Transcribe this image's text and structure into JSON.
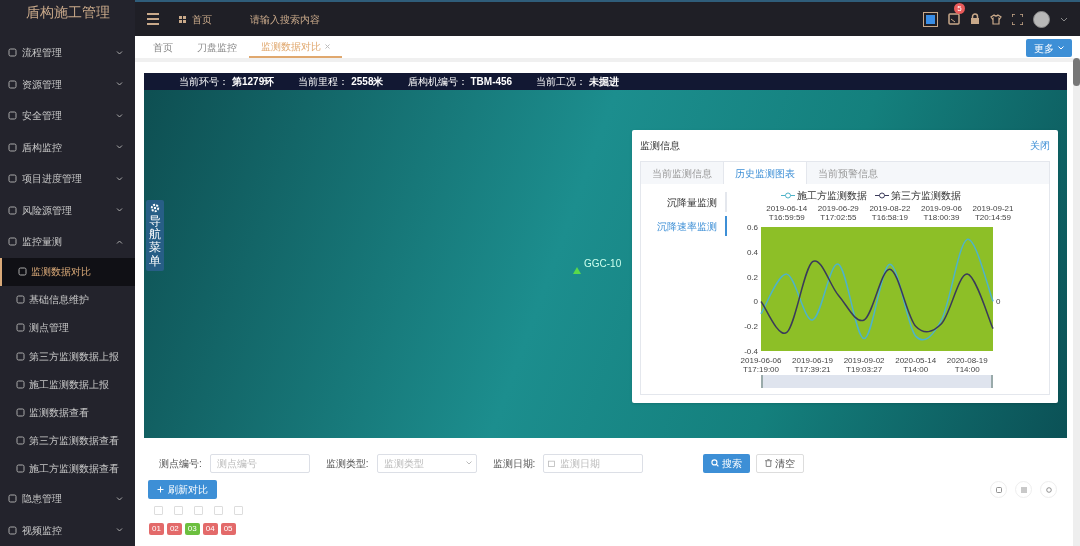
{
  "app": {
    "title": "盾构施工管理"
  },
  "header": {
    "home": "首页",
    "search": {
      "placeholder": "请输入搜索内容"
    },
    "badge": "5"
  },
  "sidebar": {
    "items": [
      {
        "label": "流程管理",
        "expanded": false
      },
      {
        "label": "资源管理",
        "expanded": false
      },
      {
        "label": "安全管理",
        "expanded": false
      },
      {
        "label": "盾构监控",
        "expanded": false
      },
      {
        "label": "项目进度管理",
        "expanded": false
      },
      {
        "label": "风险源管理",
        "expanded": false
      },
      {
        "label": "监控量测",
        "expanded": true,
        "children": [
          {
            "label": "监测数据对比",
            "selected": true
          },
          {
            "label": "基础信息维护",
            "selected": false
          },
          {
            "label": "测点管理",
            "selected": false
          },
          {
            "label": "第三方监测数据上报",
            "selected": false
          },
          {
            "label": "施工监测数据上报",
            "selected": false
          },
          {
            "label": "监测数据查看",
            "selected": false
          },
          {
            "label": "第三方监测数据查看",
            "selected": false
          },
          {
            "label": "施工方监测数据查看",
            "selected": false
          }
        ]
      },
      {
        "label": "隐患管理",
        "expanded": false
      },
      {
        "label": "视频监控",
        "expanded": false
      }
    ]
  },
  "tabs": [
    {
      "label": "首页",
      "selected": false,
      "closable": false
    },
    {
      "label": "刀盘监控",
      "selected": false,
      "closable": false
    },
    {
      "label": "监测数据对比",
      "selected": true,
      "closable": true
    }
  ],
  "more_button": "更多",
  "status_bar": [
    {
      "label": "当前环号：",
      "value": "第1279环"
    },
    {
      "label": "当前里程：",
      "value": "2558米"
    },
    {
      "label": "盾构机编号：",
      "value": "TBM-456"
    },
    {
      "label": "当前工况：",
      "value": "未掘进"
    }
  ],
  "scene": {
    "nav_menu": "导航菜单",
    "marker": "GGC-10"
  },
  "panel": {
    "title": "监测信息",
    "close": "关闭",
    "tabs": [
      {
        "label": "当前监测信息",
        "selected": false
      },
      {
        "label": "历史监测图表",
        "selected": true
      },
      {
        "label": "当前预警信息",
        "selected": false
      }
    ],
    "side_items": [
      {
        "label": "沉降量监测",
        "selected": false
      },
      {
        "label": "沉降速率监测",
        "selected": true
      }
    ],
    "chart_data": {
      "type": "line",
      "categories": [
        "2019-06-06 T17:19:00",
        "2019-06-14 T16:59:59",
        "2019-06-19 T17:39:21",
        "2019-06-29 T17:02:55",
        "2019-09-02 T19:03:27",
        "2019-08-22 T16:58:19",
        "2020-05-14 T14:00",
        "2019-09-06 T18:00:39",
        "2020-08-19 T14:00",
        "2019-09-21 T20:14:59"
      ],
      "series": [
        {
          "name": "施工方监测数据",
          "color": "#4fb3c8",
          "values": [
            -0.1,
            0.22,
            -0.15,
            0.3,
            -0.3,
            0.3,
            -0.28,
            -0.15,
            0.5,
            0.0
          ]
        },
        {
          "name": "第三方监测数据",
          "color": "#3a3a5a",
          "values": [
            0.0,
            -0.25,
            0.32,
            0.05,
            -0.15,
            0.26,
            -0.2,
            -0.18,
            0.22,
            -0.22
          ]
        }
      ],
      "ylim": [
        -0.4,
        0.6
      ],
      "yticks": [
        -0.4,
        -0.2,
        0,
        0.2,
        0.4,
        0.6
      ],
      "annotations": [
        "0"
      ]
    },
    "zoom_slider": {
      "level": 1
    }
  },
  "filters": [
    {
      "kind": "input",
      "label": "测点编号:",
      "placeholder": "测点编号"
    },
    {
      "kind": "select",
      "label": "监测类型:",
      "placeholder": "监测类型"
    },
    {
      "kind": "date",
      "label": "监测日期:",
      "placeholder": "监测日期"
    }
  ],
  "search_button": "搜索",
  "clear_button": "清空",
  "refresh_button": "刷新对比",
  "checkboxes": [
    {
      "checked": false
    },
    {
      "checked": false
    },
    {
      "checked": false
    },
    {
      "checked": false
    },
    {
      "checked": false
    }
  ],
  "tags": [
    {
      "label": "01",
      "color": "#e36a6a"
    },
    {
      "label": "02",
      "color": "#e36a6a"
    },
    {
      "label": "03",
      "color": "#6cbf3f"
    },
    {
      "label": "04",
      "color": "#e36a6a"
    },
    {
      "label": "05",
      "color": "#e36a6a"
    }
  ]
}
